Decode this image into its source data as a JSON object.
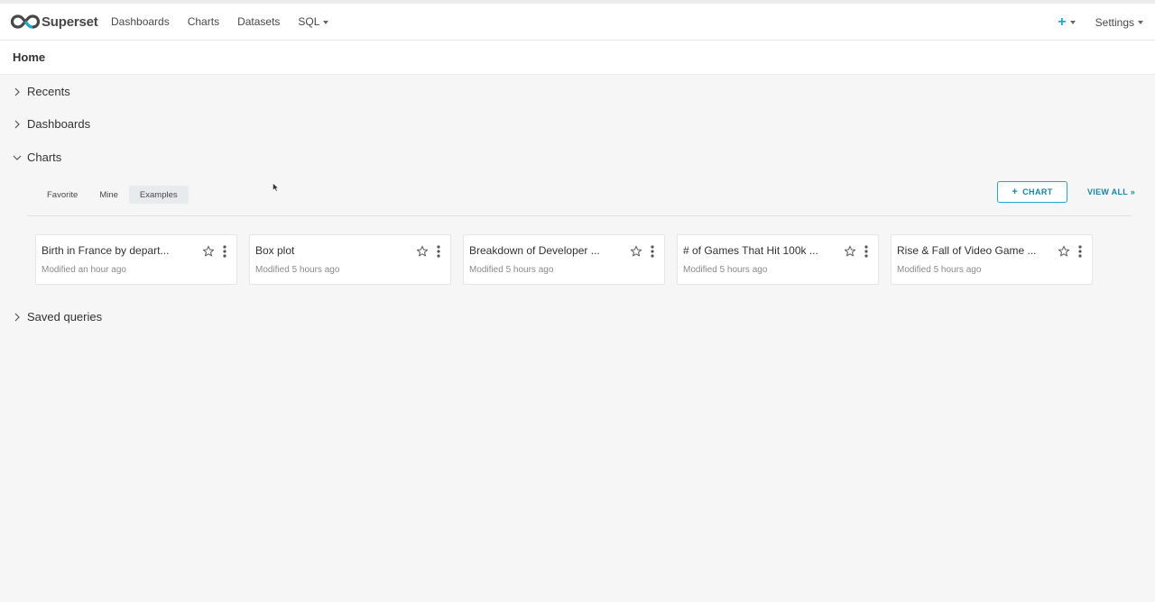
{
  "app": {
    "brand": "Superset"
  },
  "nav": {
    "items": [
      {
        "label": "Dashboards"
      },
      {
        "label": "Charts"
      },
      {
        "label": "Datasets"
      },
      {
        "label": "SQL"
      }
    ],
    "settings_label": "Settings"
  },
  "page": {
    "title": "Home"
  },
  "sections": {
    "recents": "Recents",
    "dashboards": "Dashboards",
    "charts": "Charts",
    "saved_queries": "Saved queries"
  },
  "charts_panel": {
    "tabs": [
      {
        "label": "Favorite",
        "active": false
      },
      {
        "label": "Mine",
        "active": false
      },
      {
        "label": "Examples",
        "active": true
      }
    ],
    "add_button": "CHART",
    "view_all": "VIEW ALL »",
    "cards": [
      {
        "title": "Birth in France by depart...",
        "modified": "Modified an hour ago"
      },
      {
        "title": "Box plot",
        "modified": "Modified 5 hours ago"
      },
      {
        "title": "Breakdown of Developer ...",
        "modified": "Modified 5 hours ago"
      },
      {
        "title": "# of Games That Hit 100k ...",
        "modified": "Modified 5 hours ago"
      },
      {
        "title": "Rise & Fall of Video Game ...",
        "modified": "Modified 5 hours ago"
      }
    ]
  },
  "icons": {
    "brand_logo": "superset-logo-icon",
    "plus": "plus-icon",
    "caret": "caret-down-icon",
    "chevron_right": "chevron-right-icon",
    "chevron_down": "chevron-down-icon",
    "star": "star-icon",
    "more": "more-vertical-icon"
  },
  "colors": {
    "accent": "#20a7c9",
    "accent_text": "#1a85a0",
    "background": "#f6f6f6",
    "logo_dark": "#484848"
  }
}
